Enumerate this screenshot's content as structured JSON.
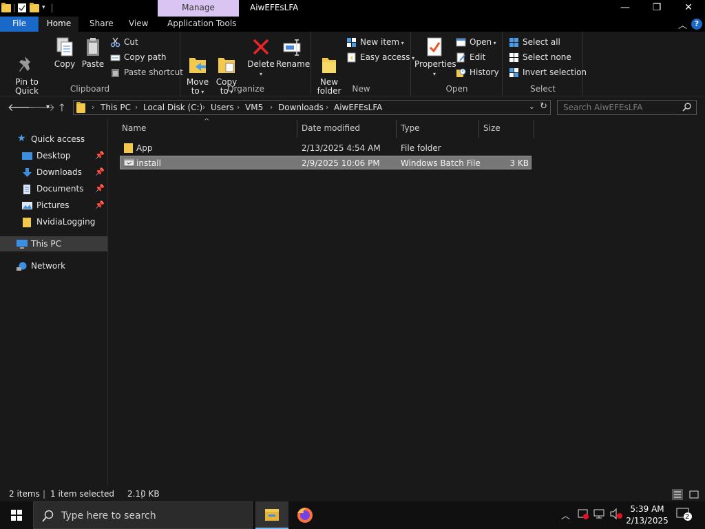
{
  "window": {
    "title": "AiwEFEsLFA",
    "manage_tab": "Manage",
    "minimize": "—",
    "maximize": "❐",
    "close": "✕"
  },
  "tabs": {
    "file": "File",
    "home": "Home",
    "share": "Share",
    "view": "View",
    "application_tools": "Application Tools"
  },
  "ribbon": {
    "clipboard": {
      "label": "Clipboard",
      "pin_to_quick_access": "Pin to Quick\naccess",
      "copy": "Copy",
      "paste": "Paste",
      "cut": "Cut",
      "copy_path": "Copy path",
      "paste_shortcut": "Paste shortcut"
    },
    "organize": {
      "label": "Organize",
      "move_to": "Move\nto",
      "copy_to": "Copy\nto",
      "delete": "Delete",
      "rename": "Rename"
    },
    "new": {
      "label": "New",
      "new_folder": "New\nfolder",
      "new_item": "New item",
      "easy_access": "Easy access"
    },
    "open": {
      "label": "Open",
      "properties": "Properties",
      "open": "Open",
      "edit": "Edit",
      "history": "History"
    },
    "select": {
      "label": "Select",
      "select_all": "Select all",
      "select_none": "Select none",
      "invert_selection": "Invert selection"
    }
  },
  "address": {
    "breadcrumbs": [
      "This PC",
      "Local Disk (C:)",
      "Users",
      "VM5",
      "Downloads",
      "AiwEFEsLFA"
    ],
    "search_placeholder": "Search AiwEFEsLFA"
  },
  "navpane": {
    "quick_access": "Quick access",
    "items": [
      "Desktop",
      "Downloads",
      "Documents",
      "Pictures",
      "NvidiaLogging"
    ],
    "this_pc": "This PC",
    "network": "Network"
  },
  "filelist": {
    "columns": [
      "Name",
      "Date modified",
      "Type",
      "Size"
    ],
    "rows": [
      {
        "name": "App",
        "date": "2/13/2025 4:54 AM",
        "type": "File folder",
        "size": ""
      },
      {
        "name": "install",
        "date": "2/9/2025 10:06 PM",
        "type": "Windows Batch File",
        "size": "3 KB"
      }
    ]
  },
  "statusbar": {
    "items": "2 items",
    "selected": "1 item selected",
    "size": "2.10 KB"
  },
  "taskbar": {
    "search_placeholder": "Type here to search",
    "time": "5:39 AM",
    "date": "2/13/2025",
    "notifications": "2"
  },
  "colors": {
    "accent": "#1a68c8",
    "manage_tab": "#d9c4f2",
    "folder": "#f2c94c"
  }
}
